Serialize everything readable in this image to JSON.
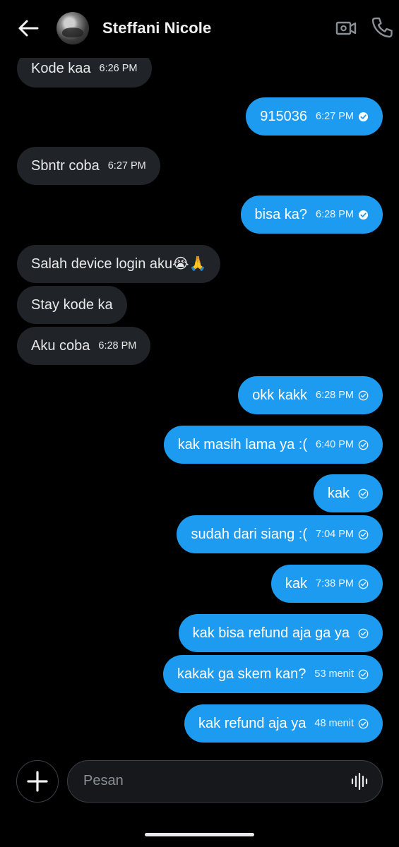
{
  "header": {
    "contact_name": "Steffani Nicole",
    "back_icon": "arrow-left-icon",
    "video_icon": "video-camera-icon",
    "call_icon": "phone-icon"
  },
  "messages": [
    {
      "direction": "in",
      "text": "Kode kaa",
      "time": "6:26 PM"
    },
    {
      "direction": "out",
      "text": "915036",
      "time": "6:27 PM",
      "status": "read"
    },
    {
      "direction": "in",
      "text": "Sbntr coba",
      "time": "6:27 PM"
    },
    {
      "direction": "out",
      "text": "bisa ka?",
      "time": "6:28 PM",
      "status": "read"
    },
    {
      "direction": "in",
      "text": "Salah device login aku😭🙏",
      "time": ""
    },
    {
      "direction": "in",
      "text": "Stay kode ka",
      "time": ""
    },
    {
      "direction": "in",
      "text": "Aku coba",
      "time": "6:28 PM"
    },
    {
      "direction": "out",
      "text": "okk kakk",
      "time": "6:28 PM",
      "status": "sent"
    },
    {
      "direction": "out",
      "text": "kak masih lama ya :(",
      "time": "6:40 PM",
      "status": "sent"
    },
    {
      "direction": "out",
      "text": "kak",
      "time": "",
      "status": "sent"
    },
    {
      "direction": "out",
      "text": "sudah dari siang :(",
      "time": "7:04 PM",
      "status": "sent"
    },
    {
      "direction": "out",
      "text": "kak",
      "time": "7:38 PM",
      "status": "sent"
    },
    {
      "direction": "out",
      "text": "kak bisa refund aja ga ya",
      "time": "",
      "status": "sent"
    },
    {
      "direction": "out",
      "text": "kakak ga skem kan?",
      "time": "53 menit",
      "status": "sent"
    },
    {
      "direction": "out",
      "text": "kak refund aja ya",
      "time": "48 menit",
      "status": "sent"
    }
  ],
  "composer": {
    "placeholder": "Pesan",
    "add_icon": "plus-icon",
    "voice_icon": "voice-waveform-icon"
  },
  "colors": {
    "background": "#000000",
    "incoming_bubble": "#202327",
    "outgoing_bubble": "#1d9bf0",
    "text": "#e7e9ea"
  }
}
